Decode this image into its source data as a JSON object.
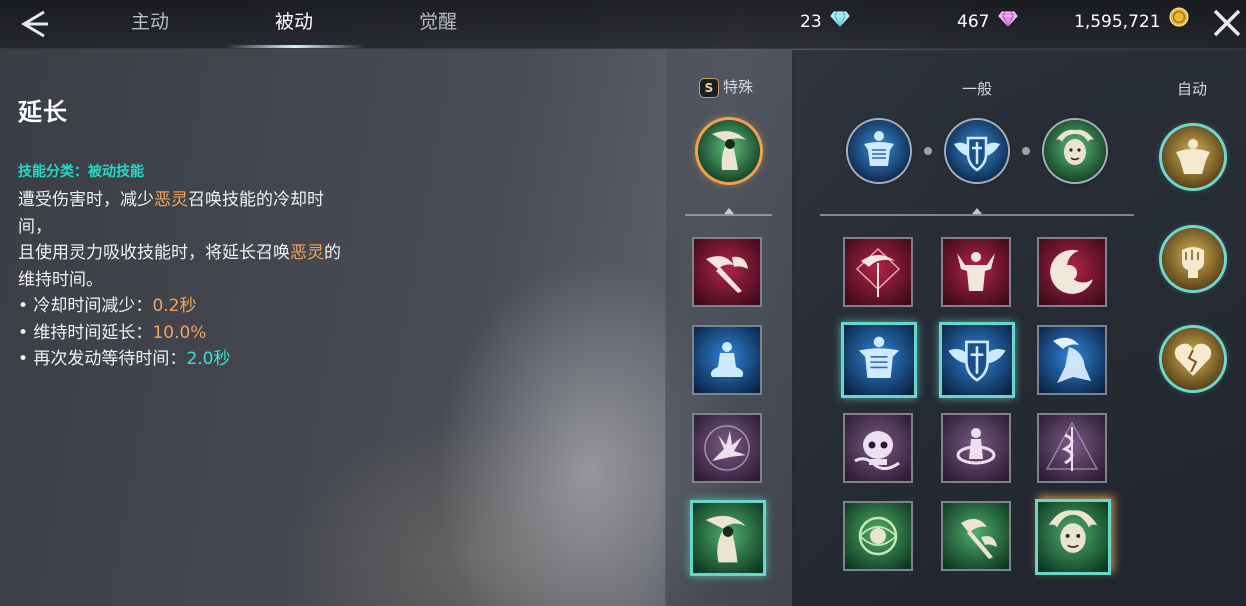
{
  "tabs": [
    {
      "label": "主动"
    },
    {
      "label": "被动"
    },
    {
      "label": "觉醒"
    }
  ],
  "currencies": [
    {
      "value": "23",
      "icon": "diamond-blue-icon"
    },
    {
      "value": "467",
      "icon": "diamond-purple-icon"
    },
    {
      "value": "1,595,721",
      "icon": "gold-coin-icon"
    }
  ],
  "skill_detail": {
    "title": "延长",
    "category": "技能分类：被动技能",
    "line1_a": "遭受伤害时，减少",
    "line1_hl": "恶灵",
    "line1_b": "召唤技能的冷却时",
    "line2": "间，",
    "line3_a": "且使用灵力吸收技能时，将延长召唤",
    "line3_hl": "恶灵",
    "line3_b": "的",
    "line4": "维持时间。",
    "stats": [
      {
        "label": "• 冷却时间减少：",
        "value": "0.2秒"
      },
      {
        "label": "• 维持时间延长：",
        "value": "10.0%"
      },
      {
        "label": "• 再次发动等待时间：",
        "value": "2.0秒"
      }
    ]
  },
  "panel": {
    "special_badge": "S",
    "special_header": "特殊",
    "general_header": "一般",
    "auto_header": "自动"
  },
  "icons": {
    "equipped_special": "reaper-green-icon",
    "equipped_general": [
      "skeleton-body-icon",
      "winged-shield-icon",
      "medusa-icon"
    ],
    "auto": [
      "muscle-body-gold-icon",
      "fist-gold-icon",
      "broken-heart-gold-icon"
    ],
    "special_list": [
      "demon-axe-crimson-icon",
      "meditation-blue-icon",
      "ghost-hand-purple-icon",
      "reaper-green-icon"
    ],
    "general_grid": [
      [
        "scythe-crimson-icon",
        "berserker-crimson-icon",
        "crescent-moon-crimson-icon"
      ],
      [
        "skeleton-body-icon",
        "winged-shield-icon",
        "wraith-scythe-blue-icon"
      ],
      [
        "skull-snake-purple-icon",
        "serpent-coil-purple-icon",
        "caduceus-purple-icon"
      ],
      [
        "celtic-knot-green-icon",
        "double-axe-green-icon",
        "medusa-icon"
      ]
    ]
  }
}
